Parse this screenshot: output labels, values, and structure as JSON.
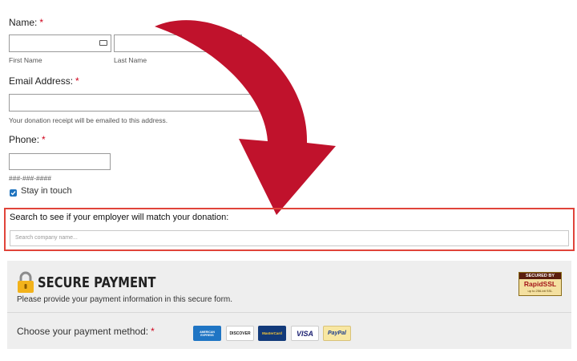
{
  "name": {
    "label": "Name:",
    "required": "*",
    "first_hint": "First Name",
    "last_hint": "Last Name"
  },
  "email": {
    "label": "Email Address:",
    "required": "*",
    "hint": "Your donation receipt will be emailed to this address."
  },
  "phone": {
    "label": "Phone:",
    "required": "*",
    "hint": "###-###-####"
  },
  "stay_in_touch": {
    "label": "Stay in touch",
    "checked": true
  },
  "employer_match": {
    "label": "Search to see if your employer will match your donation:",
    "placeholder": "Search company name..."
  },
  "payment": {
    "title": "SECURE PAYMENT",
    "subtitle": "Please provide your payment information in this secure form.",
    "method_label": "Choose your payment method:",
    "required": "*",
    "badge": {
      "line1": "SECURED BY",
      "line2": "RapidSSL",
      "line3": "up to 256-bit SSL"
    },
    "cards": [
      {
        "name": "AMERICAN EXPRESS"
      },
      {
        "name": "DISCOVER"
      },
      {
        "name": "MasterCard"
      },
      {
        "name": "VISA"
      },
      {
        "name": "PayPal"
      }
    ]
  },
  "colors": {
    "accent_red": "#c0122c",
    "required": "#d0021b",
    "highlight_border": "#e0443a"
  }
}
